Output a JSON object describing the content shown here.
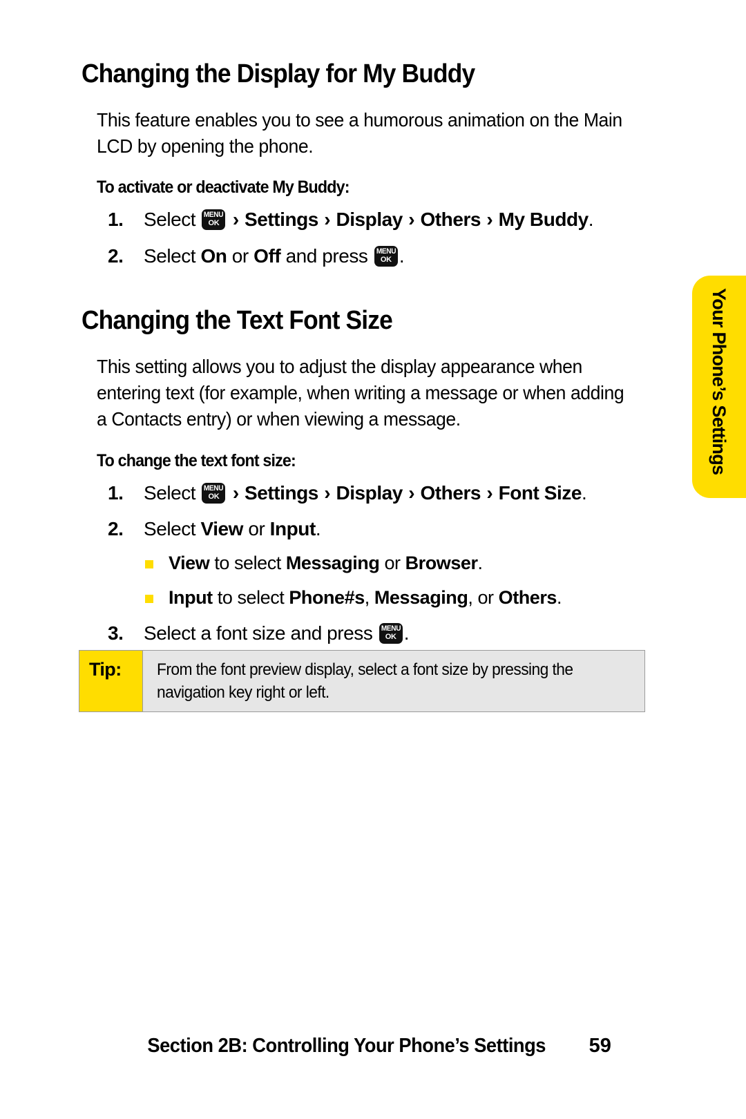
{
  "page": {
    "background": "#ffffff",
    "accent_yellow": "#FFDD00",
    "tip_bg": "#E6E6E6"
  },
  "section1": {
    "heading": "Changing the Display for My Buddy",
    "paragraph": "This feature enables you to see a humorous animation on the Main LCD by opening the phone.",
    "sub_heading": "To activate or deactivate My Buddy:",
    "steps": [
      {
        "num": "1.",
        "prefix": "Select",
        "key": {
          "line1": "MENU",
          "line2": "OK"
        },
        "chevron": "›",
        "path": [
          "Settings",
          "Display",
          "Others",
          "My Buddy"
        ],
        "suffix": "."
      },
      {
        "num": "2.",
        "prefix": "Select",
        "option_a": "On",
        "conj": "or",
        "option_b": "Off",
        "middle": "and press",
        "key": {
          "line1": "MENU",
          "line2": "OK"
        },
        "suffix": "."
      }
    ]
  },
  "section2": {
    "heading": "Changing the Text Font Size",
    "paragraph": "This setting allows you to adjust the display appearance when entering text (for example, when writing a message or when adding a Contacts entry) or when viewing a message.",
    "sub_heading": "To change the text font size:",
    "steps": [
      {
        "num": "1.",
        "prefix": "Select",
        "key": {
          "line1": "MENU",
          "line2": "OK"
        },
        "chevron": "›",
        "path": [
          "Settings",
          "Display",
          "Others",
          "Font Size"
        ],
        "suffix": "."
      },
      {
        "num": "2.",
        "prefix": "Select",
        "option_a": "View",
        "conj": "or",
        "option_b": "Input",
        "suffix": ".",
        "sub_bullets": [
          {
            "lead": "View",
            "mid": "to select",
            "opt_a": "Messaging",
            "conj": "or",
            "opt_b": "Browser",
            "end": "."
          },
          {
            "lead": "Input",
            "mid": "to select",
            "opt_a": "Phone#s",
            "comma": ",",
            "opt_b": "Messaging",
            "conj": ", or",
            "opt_c": "Others",
            "end": "."
          }
        ]
      },
      {
        "num": "3.",
        "prefix": "Select a font size and press",
        "key": {
          "line1": "MENU",
          "line2": "OK"
        },
        "suffix": "."
      }
    ]
  },
  "tip": {
    "label": "Tip:",
    "text": "From the font preview display, select a font size by pressing the navigation key right or left."
  },
  "side_tab": {
    "label": "Your Phone’s Settings"
  },
  "footer": {
    "title": "Section 2B: Controlling Your Phone’s Settings",
    "page_number": "59"
  }
}
